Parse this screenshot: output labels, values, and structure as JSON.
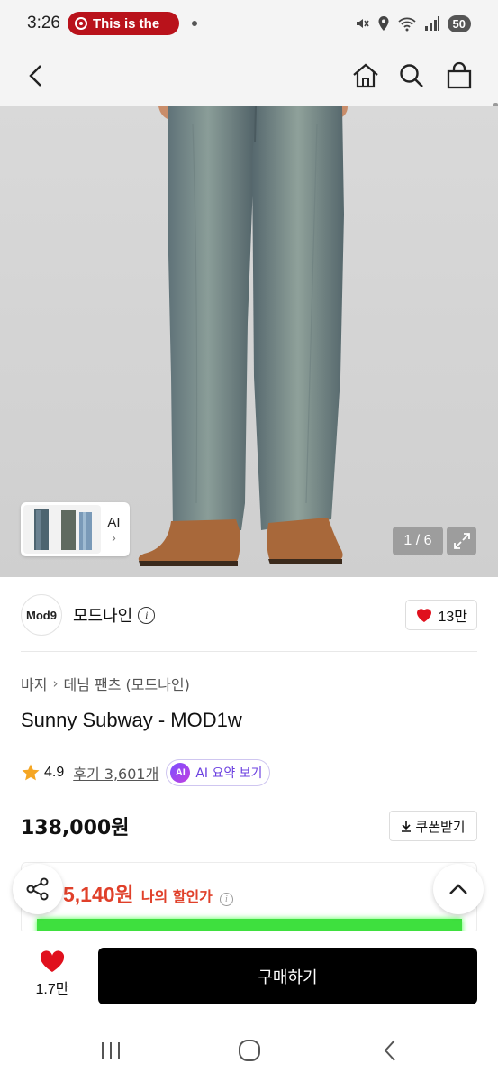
{
  "status_bar": {
    "time": "3:26",
    "media_text": "This is the",
    "battery": "50"
  },
  "nav": {
    "back_icon": "chevron-left-icon",
    "home_icon": "home-icon",
    "search_icon": "search-icon",
    "bag_icon": "shopping-bag-icon"
  },
  "gallery": {
    "thumb_label": "AI",
    "pager": "1 / 6"
  },
  "brand": {
    "logo_text": "Mod9",
    "name": "모드나인",
    "likes": "13만"
  },
  "product": {
    "breadcrumb": [
      "바지",
      "데님 팬츠 (모드나인)"
    ],
    "title": "Sunny Subway - MOD1w",
    "rating": "4.9",
    "reviews": "후기 3,601개",
    "ai_badge": "AI",
    "ai_summary": "AI 요약 보기",
    "price": "138,000원",
    "coupon": "쿠폰받기"
  },
  "discount": {
    "amount": "5,140원",
    "label": "나의 할인가"
  },
  "bottom_bar": {
    "likes": "1.7만",
    "buy": "구매하기"
  },
  "colors": {
    "accent_red": "#e0402a",
    "heart_red": "#e0101d",
    "star": "#f5a623",
    "ai_purple": "#6b3fe0",
    "buy_button": "#000000"
  }
}
